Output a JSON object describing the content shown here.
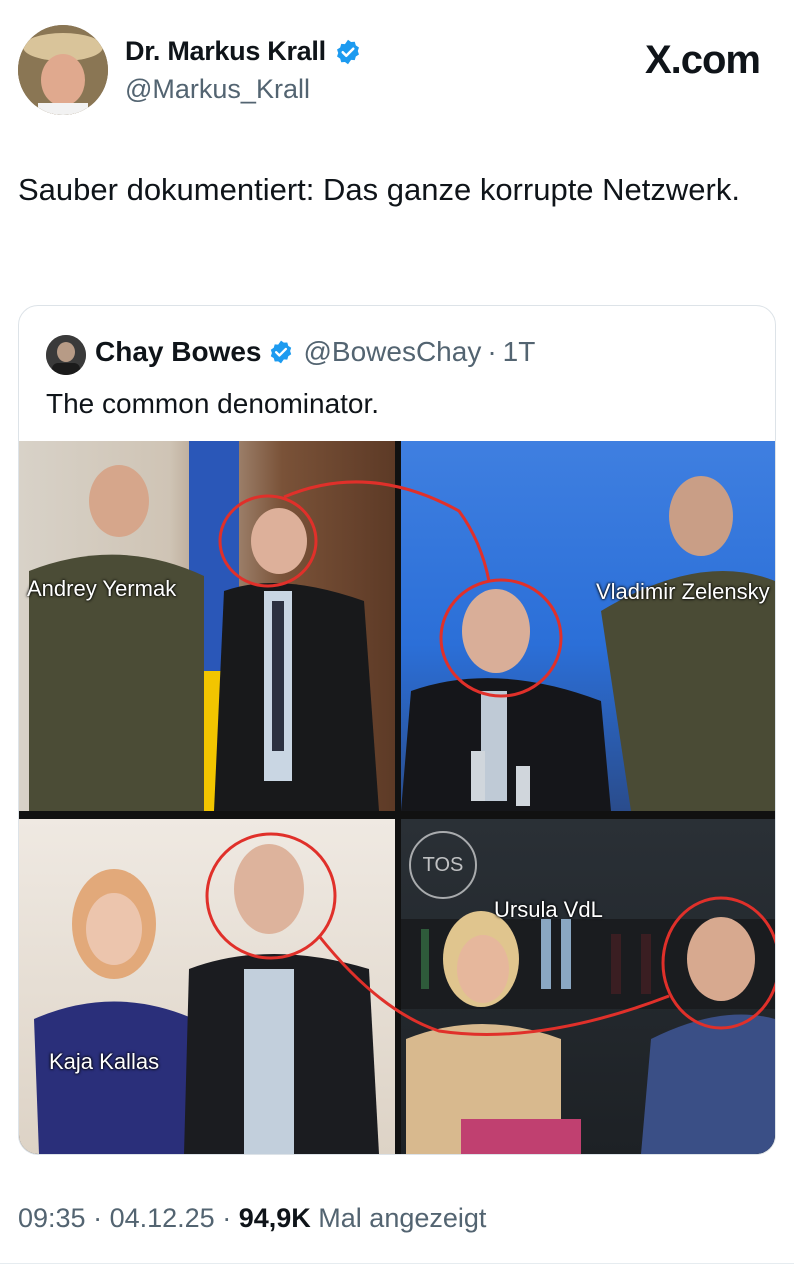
{
  "tweet": {
    "author": {
      "name": "Dr. Markus Krall",
      "handle": "@Markus_Krall",
      "verified": true
    },
    "brand": "X.com",
    "text": "Sauber dokumentiert: Das ganze korrupte Netzwerk.",
    "footer": {
      "time": "09:35",
      "date": "04.12.25",
      "views": "94,9K",
      "views_label": "Mal angezeigt"
    }
  },
  "quote": {
    "author": {
      "name": "Chay Bowes",
      "handle": "@BowesChay",
      "verified": true
    },
    "age": "1T",
    "text": "The common denominator.",
    "image_labels": {
      "top_left": "Andrey Yermak",
      "top_right": "Vladimir Zelensky",
      "bottom_left": "Kaja Kallas",
      "bottom_right": "Ursula VdL",
      "watermark": "TOS"
    }
  },
  "colors": {
    "verified_badge": "#1d9bf0",
    "secondary_text": "#536471",
    "circle_highlight": "#e0302a"
  }
}
